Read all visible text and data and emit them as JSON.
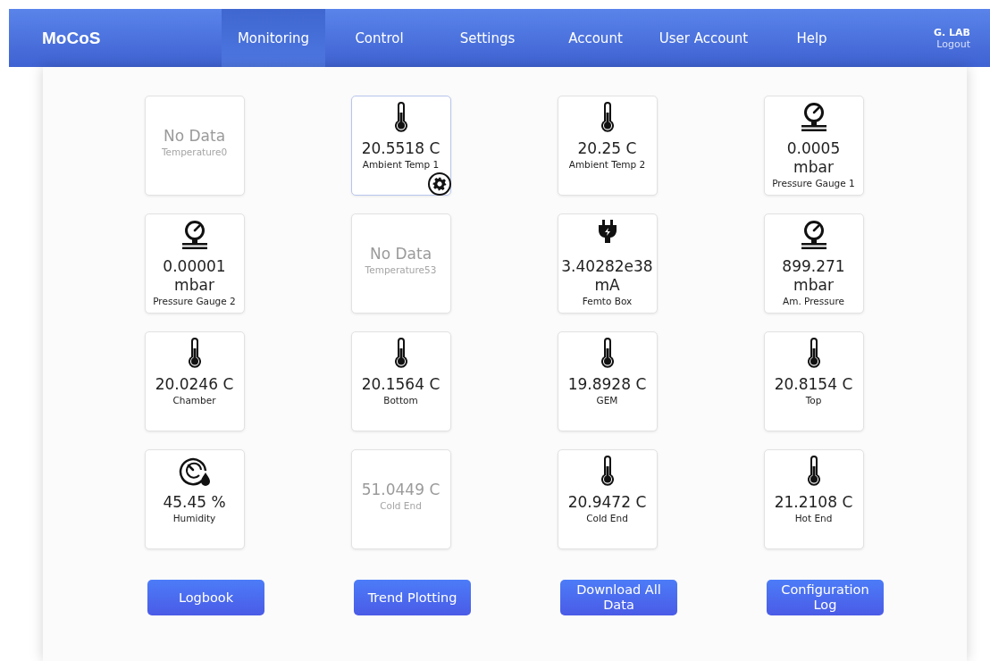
{
  "header": {
    "brand": "MoCoS",
    "nav": [
      {
        "label": "Monitoring",
        "selected": true
      },
      {
        "label": "Control",
        "selected": false
      },
      {
        "label": "Settings",
        "selected": false
      },
      {
        "label": "Account",
        "selected": false
      },
      {
        "label": "User Account",
        "selected": false
      },
      {
        "label": "Help",
        "selected": false
      }
    ],
    "user": {
      "name": "G. LAB",
      "logout": "Logout"
    }
  },
  "tiles": [
    {
      "kind": "none",
      "reading": [
        "No Data"
      ],
      "label": "Temperature0",
      "stale": true,
      "selected": false
    },
    {
      "kind": "thermometer",
      "reading": [
        "20.5518 C"
      ],
      "label": "Ambient Temp 1",
      "stale": false,
      "selected": true
    },
    {
      "kind": "thermometer",
      "reading": [
        "20.25 C"
      ],
      "label": "Ambient Temp 2",
      "stale": false,
      "selected": false
    },
    {
      "kind": "gauge",
      "reading": [
        "0.0005",
        "mbar"
      ],
      "label": "Pressure Gauge 1",
      "stale": false,
      "selected": false
    },
    {
      "kind": "gauge",
      "reading": [
        "0.00001",
        "mbar"
      ],
      "label": "Pressure Gauge 2",
      "stale": false,
      "selected": false
    },
    {
      "kind": "none",
      "reading": [
        "No Data"
      ],
      "label": "Temperature53",
      "stale": true,
      "selected": false
    },
    {
      "kind": "plug",
      "reading": [
        "3.40282e38",
        "mA"
      ],
      "label": "Femto Box",
      "stale": false,
      "selected": false
    },
    {
      "kind": "gauge",
      "reading": [
        "899.271",
        "mbar"
      ],
      "label": "Am. Pressure",
      "stale": false,
      "selected": false
    },
    {
      "kind": "thermometer",
      "reading": [
        "20.0246 C"
      ],
      "label": "Chamber",
      "stale": false,
      "selected": false
    },
    {
      "kind": "thermometer",
      "reading": [
        "20.1564 C"
      ],
      "label": "Bottom",
      "stale": false,
      "selected": false
    },
    {
      "kind": "thermometer",
      "reading": [
        "19.8928 C"
      ],
      "label": "GEM",
      "stale": false,
      "selected": false
    },
    {
      "kind": "thermometer",
      "reading": [
        "20.8154 C"
      ],
      "label": "Top",
      "stale": false,
      "selected": false
    },
    {
      "kind": "humidity",
      "reading": [
        "45.45 %"
      ],
      "label": "Humidity",
      "stale": false,
      "selected": false
    },
    {
      "kind": "none",
      "reading": [
        "51.0449 C"
      ],
      "label": "Cold End",
      "stale": true,
      "selected": false
    },
    {
      "kind": "thermometer",
      "reading": [
        "20.9472 C"
      ],
      "label": "Cold End",
      "stale": false,
      "selected": false
    },
    {
      "kind": "thermometer",
      "reading": [
        "21.2108 C"
      ],
      "label": "Hot End",
      "stale": false,
      "selected": false
    }
  ],
  "buttons": [
    [
      "Logbook"
    ],
    [
      "Trend Plotting"
    ],
    [
      "Download All",
      "Data"
    ],
    [
      "Configuration",
      "Log"
    ]
  ]
}
